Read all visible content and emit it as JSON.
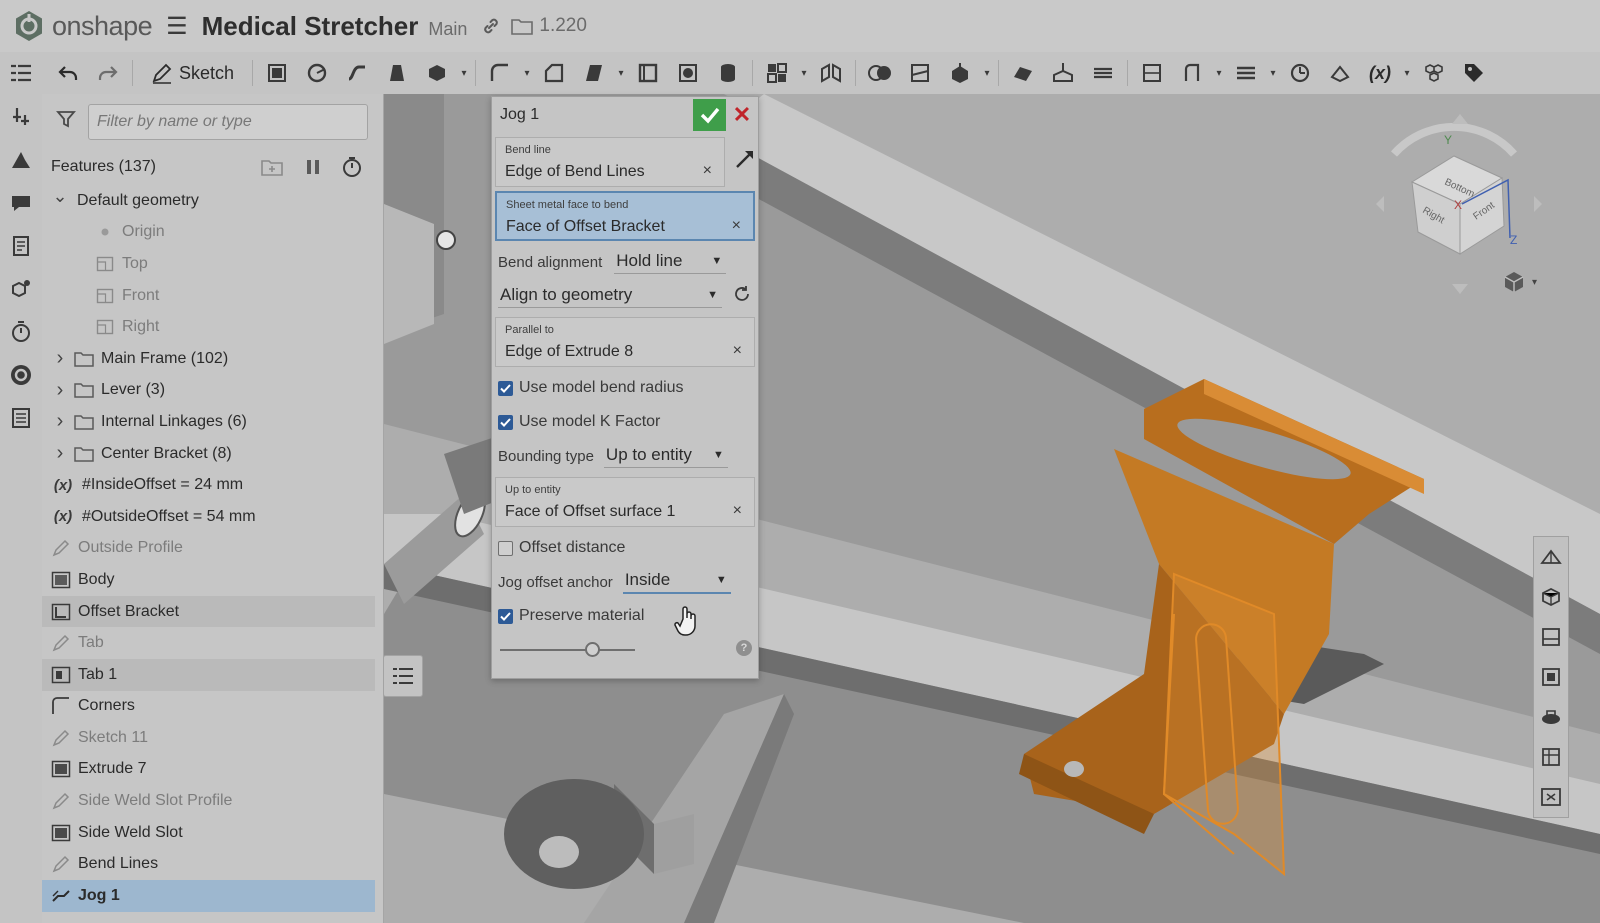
{
  "app": {
    "name": "onshape"
  },
  "document": {
    "title": "Medical Stretcher",
    "branch": "Main",
    "version": "1.220"
  },
  "toolbar": {
    "sketch_label": "Sketch"
  },
  "features": {
    "filter_placeholder": "Filter by name or type",
    "header": "Features (137)",
    "items": [
      {
        "label": "Default geometry",
        "caret": "v",
        "icon": "none",
        "indent": 0,
        "style": "normal"
      },
      {
        "label": "Origin",
        "caret": "",
        "icon": "origin-icon",
        "indent": 1,
        "style": "dim"
      },
      {
        "label": "Top",
        "caret": "",
        "icon": "plane-icon",
        "indent": 1,
        "style": "dim"
      },
      {
        "label": "Front",
        "caret": "",
        "icon": "plane-icon",
        "indent": 1,
        "style": "dim"
      },
      {
        "label": "Right",
        "caret": "",
        "icon": "plane-icon",
        "indent": 1,
        "style": "dim"
      },
      {
        "label": "Main Frame (102)",
        "caret": ">",
        "icon": "folder-icon",
        "indent": 0,
        "style": "normal"
      },
      {
        "label": "Lever (3)",
        "caret": ">",
        "icon": "folder-icon",
        "indent": 0,
        "style": "normal"
      },
      {
        "label": "Internal Linkages (6)",
        "caret": ">",
        "icon": "folder-icon",
        "indent": 0,
        "style": "normal"
      },
      {
        "label": "Center Bracket (8)",
        "caret": ">",
        "icon": "folder-icon",
        "indent": 0,
        "style": "normal"
      },
      {
        "label": "#InsideOffset = 24 mm",
        "caret": "",
        "icon": "variable-icon",
        "indent": -1,
        "style": "normal"
      },
      {
        "label": "#OutsideOffset = 54 mm",
        "caret": "",
        "icon": "variable-icon",
        "indent": -1,
        "style": "normal"
      },
      {
        "label": "Outside Profile",
        "caret": "",
        "icon": "sketch-icon",
        "indent": -1,
        "style": "dim"
      },
      {
        "label": "Body",
        "caret": "",
        "icon": "sheet-metal-icon",
        "indent": -1,
        "style": "normal"
      },
      {
        "label": "Offset Bracket",
        "caret": "",
        "icon": "bracket-icon",
        "indent": -1,
        "style": "hl"
      },
      {
        "label": "Tab",
        "caret": "",
        "icon": "sketch-icon",
        "indent": -1,
        "style": "dim"
      },
      {
        "label": "Tab 1",
        "caret": "",
        "icon": "tab-icon",
        "indent": -1,
        "style": "hl"
      },
      {
        "label": "Corners",
        "caret": "",
        "icon": "corner-icon",
        "indent": -1,
        "style": "normal"
      },
      {
        "label": "Sketch 11",
        "caret": "",
        "icon": "sketch-icon",
        "indent": -1,
        "style": "dim"
      },
      {
        "label": "Extrude 7",
        "caret": "",
        "icon": "extrude-icon",
        "indent": -1,
        "style": "normal"
      },
      {
        "label": "Side Weld Slot Profile",
        "caret": "",
        "icon": "sketch-icon",
        "indent": -1,
        "style": "dim"
      },
      {
        "label": "Side Weld Slot",
        "caret": "",
        "icon": "extrude-icon",
        "indent": -1,
        "style": "normal"
      },
      {
        "label": "Bend Lines",
        "caret": "",
        "icon": "sketch-icon",
        "indent": -1,
        "style": "normal"
      },
      {
        "label": "Jog 1",
        "caret": "",
        "icon": "jog-icon",
        "indent": -1,
        "style": "sel"
      }
    ]
  },
  "jog": {
    "title": "Jog 1",
    "bend_line": {
      "label": "Bend line",
      "value": "Edge of Bend Lines"
    },
    "face": {
      "label": "Sheet metal face to bend",
      "value": "Face of Offset Bracket"
    },
    "bend_alignment": {
      "label": "Bend alignment",
      "value": "Hold line"
    },
    "align": {
      "value": "Align to geometry"
    },
    "parallel": {
      "label": "Parallel to",
      "value": "Edge of Extrude 8"
    },
    "use_radius": {
      "label": "Use model bend radius",
      "checked": true
    },
    "use_k": {
      "label": "Use model K Factor",
      "checked": true
    },
    "bounding": {
      "label": "Bounding type",
      "value": "Up to entity"
    },
    "up_to": {
      "label": "Up to entity",
      "value": "Face of Offset surface 1"
    },
    "offset_distance": {
      "label": "Offset distance",
      "checked": false
    },
    "anchor": {
      "label": "Jog offset anchor",
      "value": "Inside"
    },
    "preserve": {
      "label": "Preserve material",
      "checked": true
    },
    "slider_level": 0.68,
    "help": "?",
    "clear": "×"
  },
  "viewcube": {
    "faces": [
      "Bottom",
      "Front",
      "Right"
    ],
    "axes": [
      "X",
      "Y",
      "Z"
    ]
  },
  "colors": {
    "accent_green": "#3f9e4a",
    "cancel_red": "#c0242a",
    "selection_blue": "#9db7cf",
    "part_orange": "#b86e1e",
    "part_orange_light": "#d98c35",
    "checkbox_blue": "#2d5a96"
  }
}
